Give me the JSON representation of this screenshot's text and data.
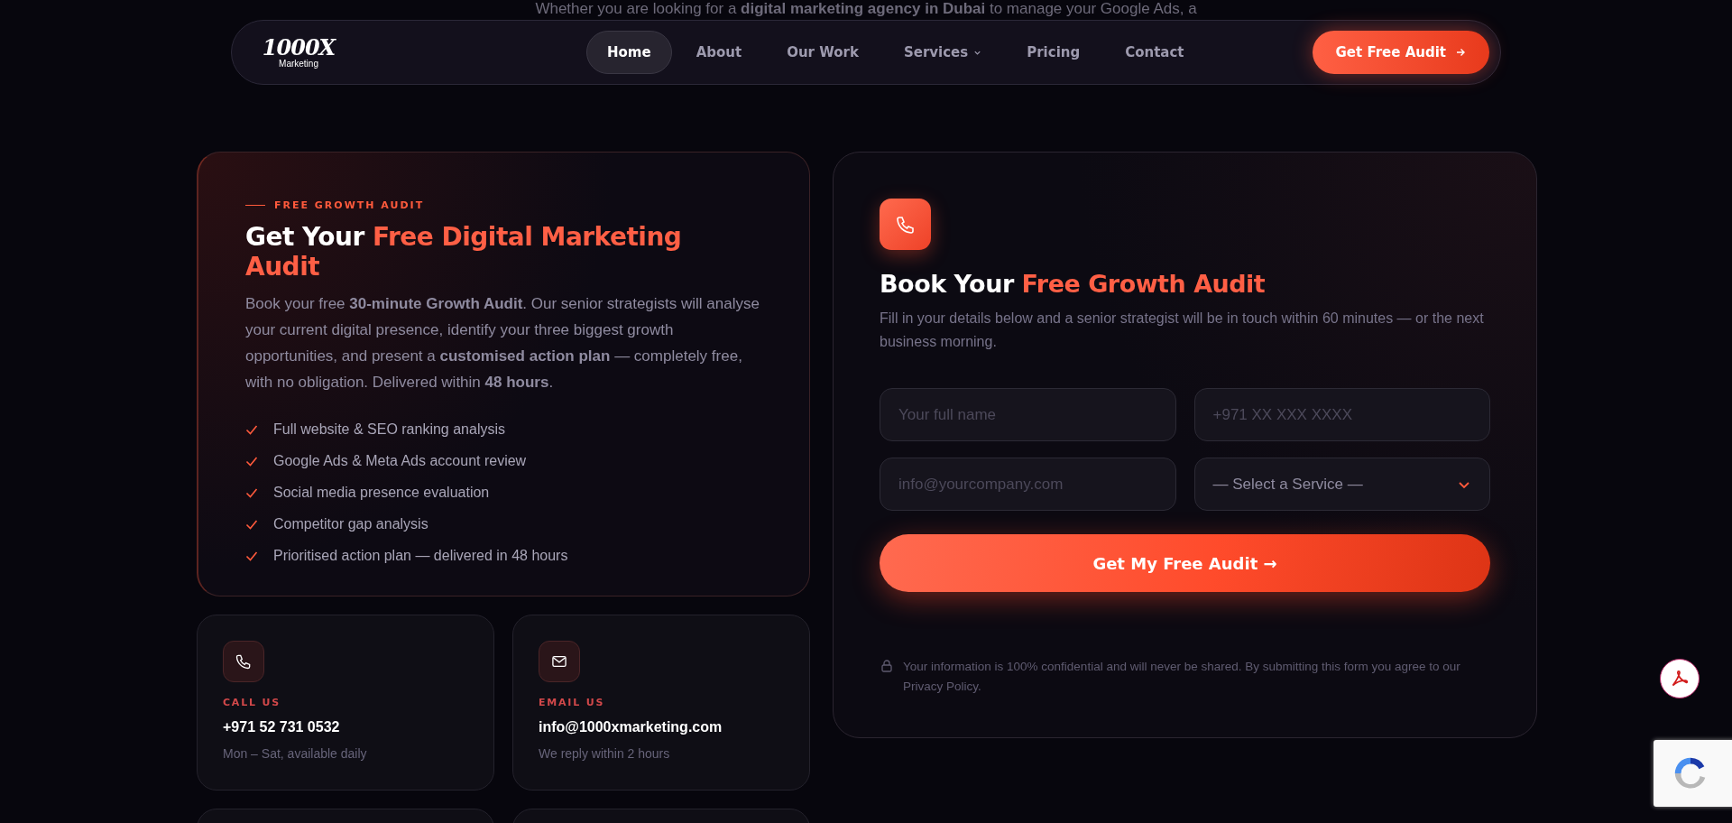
{
  "intro_text": "Whether you are looking for a **digital marketing agency in Dubai** to manage your Google Ads, a",
  "nav": {
    "logo": {
      "main": "1000X",
      "sub": "Marketing"
    },
    "links": [
      {
        "label": "Home",
        "selected": true,
        "kind": "link"
      },
      {
        "label": "About",
        "selected": false,
        "kind": "link"
      },
      {
        "label": "Our Work",
        "selected": false,
        "kind": "link"
      },
      {
        "label": "Services",
        "selected": false,
        "kind": "dropdown"
      },
      {
        "label": "Pricing",
        "selected": false,
        "kind": "link"
      },
      {
        "label": "Contact",
        "selected": false,
        "kind": "link"
      }
    ],
    "cta": "Get Free Audit"
  },
  "audit_card": {
    "kicker": "FREE GROWTH AUDIT",
    "title": "Get Your",
    "title_accent": "Free Digital Marketing Audit",
    "body": "Book your free **30-minute Growth Audit**. Our senior strategists will analyse your current digital presence, identify your three biggest growth opportunities, and present a **customised action plan** — completely free, with no obligation. Delivered within **48 hours**.",
    "checklist": [
      "Full website & SEO ranking analysis",
      "Google Ads & Meta Ads account review",
      "Social media presence evaluation",
      "Competitor gap analysis",
      "Prioritised action plan — delivered in 48 hours"
    ]
  },
  "contact_cards": [
    {
      "kind": "phone",
      "label": "CALL US",
      "value": "+971 52 731 0532",
      "note": "Mon – Sat, available daily"
    },
    {
      "kind": "email",
      "label": "EMAIL US",
      "value": "info@1000xmarketing.com",
      "note": "We reply within 2 hours"
    }
  ],
  "form": {
    "title": "Book Your",
    "title_accent": "Free Growth Audit",
    "subtitle": "Fill in your details below and a senior strategist will be in touch within 60 minutes — or the next business morning.",
    "fields": [
      {
        "kind": "text",
        "placeholder": "Your full name"
      },
      {
        "kind": "text",
        "placeholder": "+971 XX XXX XXXX"
      },
      {
        "kind": "text",
        "placeholder": "info@yourcompany.com"
      },
      {
        "kind": "select",
        "placeholder": "— Select a Service —"
      }
    ],
    "submit": "Get My Free Audit →",
    "privacy": "Your information is 100% confidential and will never be shared. By submitting this form you agree to our Privacy Policy."
  }
}
